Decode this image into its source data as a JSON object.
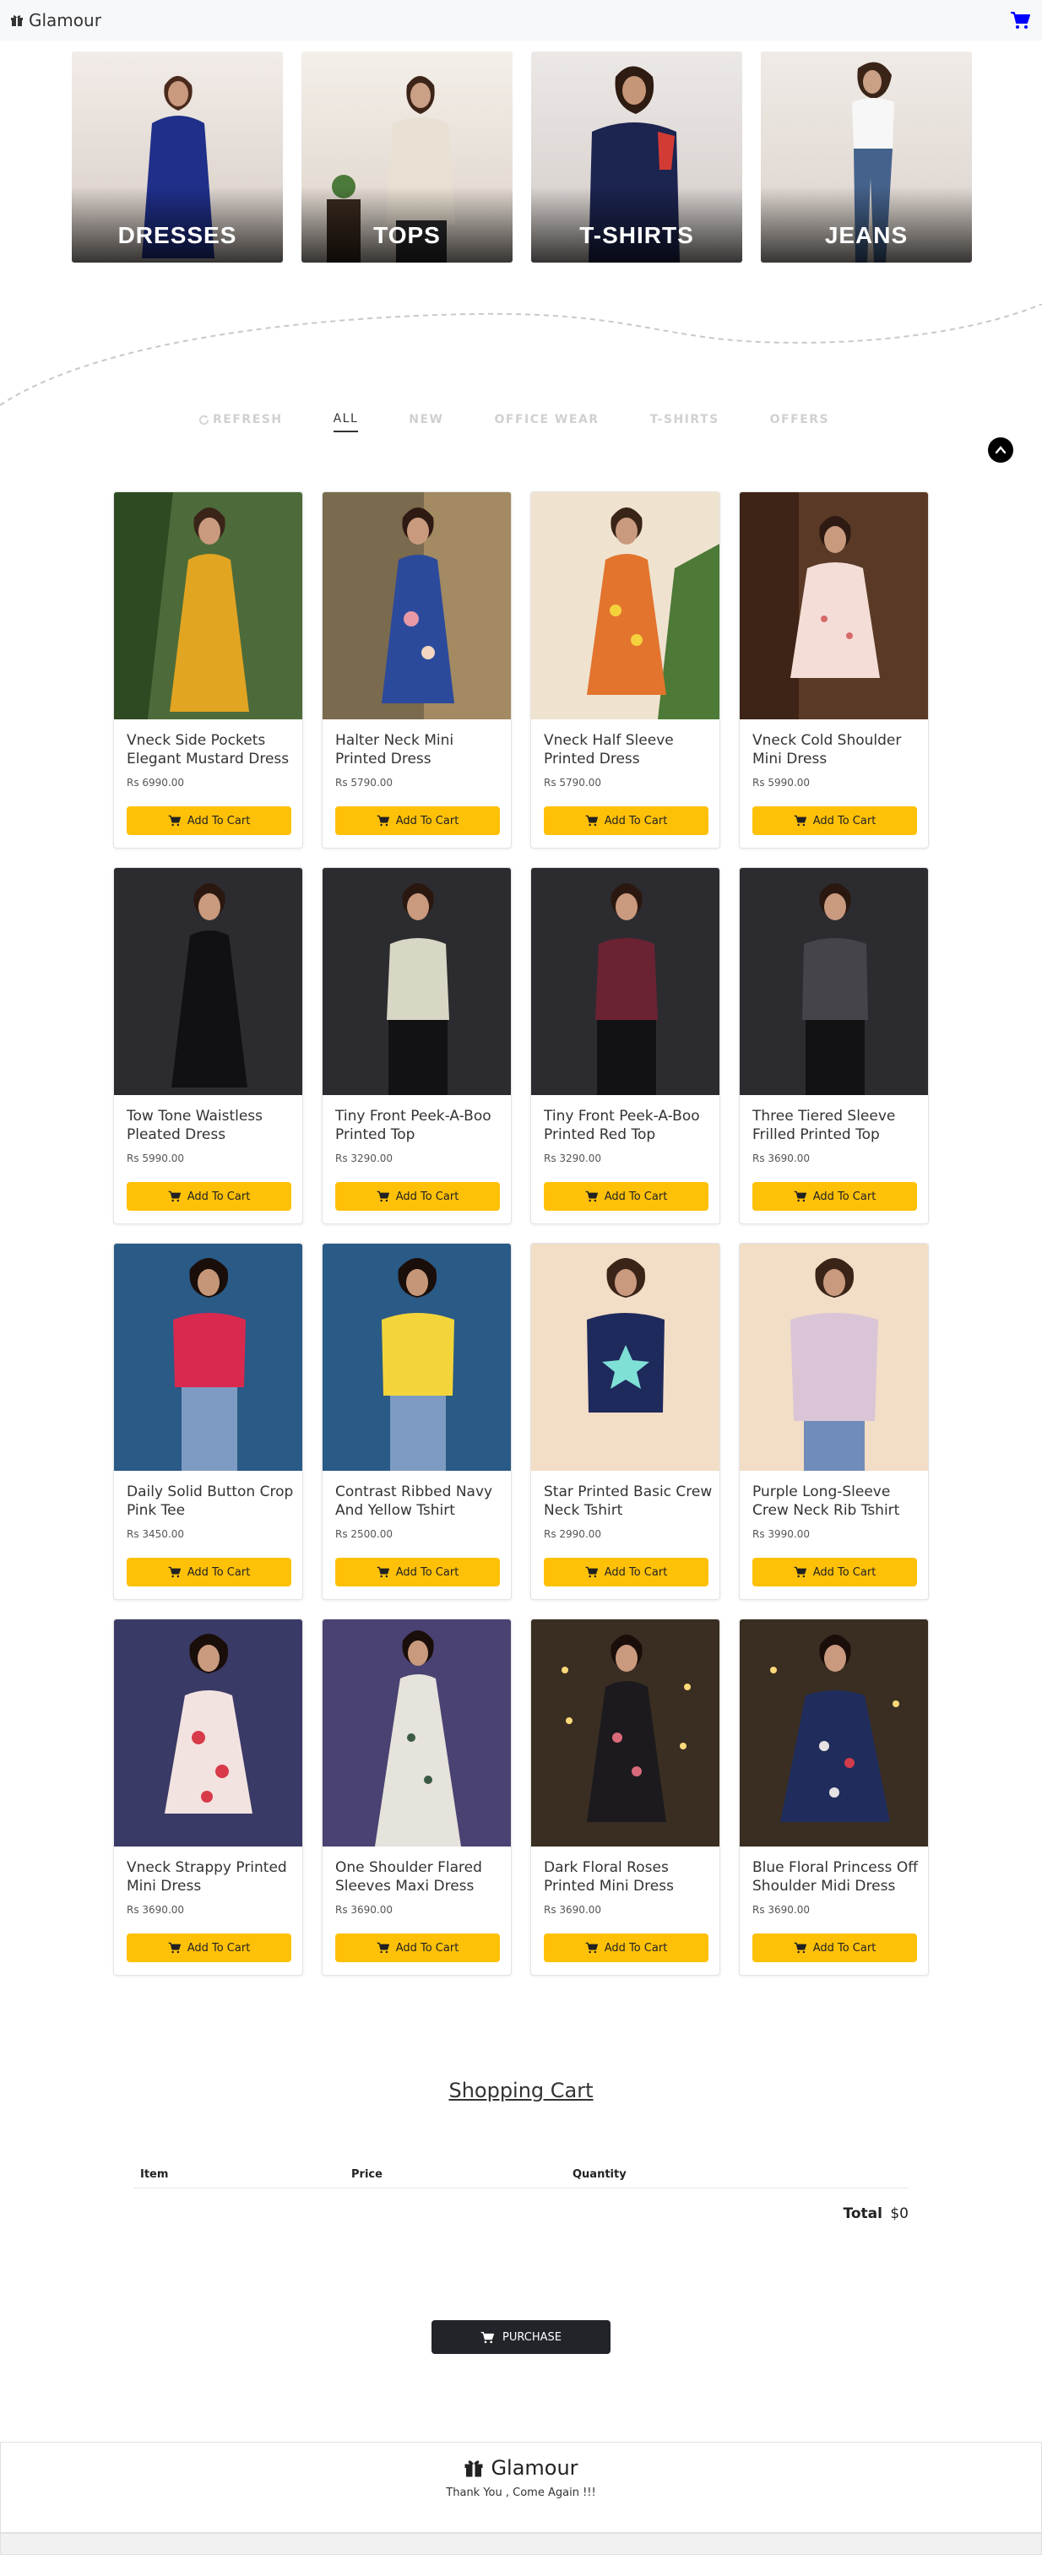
{
  "navbar": {
    "brand": "Glamour",
    "brand_icon": "gift-icon",
    "cart_icon": "cart-icon",
    "cart_color": "#0000ff"
  },
  "categories": [
    {
      "label": "DRESSES"
    },
    {
      "label": "TOPS"
    },
    {
      "label": "T-SHIRTS"
    },
    {
      "label": "JEANS"
    }
  ],
  "filters": {
    "refresh": "REFRESH",
    "items": [
      "ALL",
      "NEW",
      "OFFICE WEAR",
      "T-SHIRTS",
      "OFFERS"
    ],
    "active": "ALL"
  },
  "products": [
    {
      "name": "Vneck Side Pockets Elegant Mustard Dress",
      "price": "Rs 6990.00",
      "button": "Add To Cart"
    },
    {
      "name": "Halter Neck Mini Printed Dress",
      "price": "Rs 5790.00",
      "button": "Add To Cart"
    },
    {
      "name": "Vneck Half Sleeve Printed Dress",
      "price": "Rs 5790.00",
      "button": "Add To Cart"
    },
    {
      "name": "Vneck Cold Shoulder Mini Dress",
      "price": "Rs 5990.00",
      "button": "Add To Cart"
    },
    {
      "name": "Tow Tone Waistless Pleated Dress",
      "price": "Rs 5990.00",
      "button": "Add To Cart"
    },
    {
      "name": "Tiny Front Peek-A-Boo Printed Top",
      "price": "Rs 3290.00",
      "button": "Add To Cart"
    },
    {
      "name": "Tiny Front Peek-A-Boo Printed Red Top",
      "price": "Rs 3290.00",
      "button": "Add To Cart"
    },
    {
      "name": "Three Tiered Sleeve Frilled Printed Top",
      "price": "Rs 3690.00",
      "button": "Add To Cart"
    },
    {
      "name": "Daily Solid Button Crop Pink Tee",
      "price": "Rs 3450.00",
      "button": "Add To Cart"
    },
    {
      "name": "Contrast Ribbed Navy And Yellow Tshirt",
      "price": "Rs 2500.00",
      "button": "Add To Cart"
    },
    {
      "name": "Star Printed Basic Crew Neck Tshirt",
      "price": "Rs 2990.00",
      "button": "Add To Cart"
    },
    {
      "name": "Purple Long-Sleeve Crew Neck Rib Tshirt",
      "price": "Rs 3990.00",
      "button": "Add To Cart"
    },
    {
      "name": "Vneck Strappy Printed Mini Dress",
      "price": "Rs 3690.00",
      "button": "Add To Cart"
    },
    {
      "name": "One Shoulder Flared Sleeves Maxi Dress",
      "price": "Rs 3690.00",
      "button": "Add To Cart"
    },
    {
      "name": "Dark Floral Roses Printed Mini Dress",
      "price": "Rs 3690.00",
      "button": "Add To Cart"
    },
    {
      "name": "Blue Floral Princess Off Shoulder Midi Dress",
      "price": "Rs 3690.00",
      "button": "Add To Cart"
    }
  ],
  "cart": {
    "title": "Shopping Cart",
    "columns": [
      "Item",
      "Price",
      "Quantity"
    ],
    "total_label": "Total",
    "total_value": "$0",
    "purchase": "PURCHASE"
  },
  "footer": {
    "brand": "Glamour",
    "message": "Thank You , Come Again !!!"
  },
  "colors": {
    "accent_button": "#ffc107",
    "dark_button": "#212529"
  }
}
